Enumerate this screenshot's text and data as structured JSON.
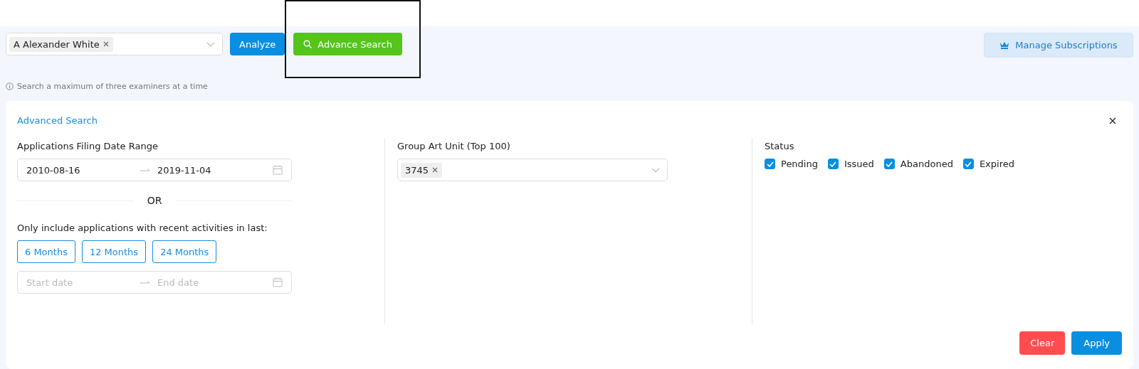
{
  "examiner_select": {
    "tags": [
      "A Alexander White"
    ]
  },
  "analyze_button": "Analyze",
  "advance_search_button": {
    "label": "Advance Search",
    "highlighted": true
  },
  "hint": "Search a maximum of three examiners at a time",
  "manage_subscriptions_button": "Manage Subscriptions",
  "advanced_search": {
    "title": "Advanced Search",
    "filing_date": {
      "label": "Applications Filing Date Range",
      "start": "2010-08-16",
      "end": "2019-11-04"
    },
    "divider_text": "OR",
    "recent_label": "Only include applications with recent activities in last:",
    "periods": [
      {
        "label": "6 Months",
        "selected": false
      },
      {
        "label": "12 Months",
        "selected": false
      },
      {
        "label": "24 Months",
        "selected": false
      }
    ],
    "custom_range": {
      "start_placeholder": "Start date",
      "end_placeholder": "End date"
    },
    "group_art_unit": {
      "label": "Group Art Unit (Top 100)",
      "tags": [
        "3745"
      ]
    },
    "status": {
      "label": "Status",
      "options": [
        {
          "label": "Pending",
          "checked": true
        },
        {
          "label": "Issued",
          "checked": true
        },
        {
          "label": "Abandoned",
          "checked": true
        },
        {
          "label": "Expired",
          "checked": true
        }
      ]
    },
    "buttons": {
      "clear": "Clear",
      "apply": "Apply"
    }
  }
}
